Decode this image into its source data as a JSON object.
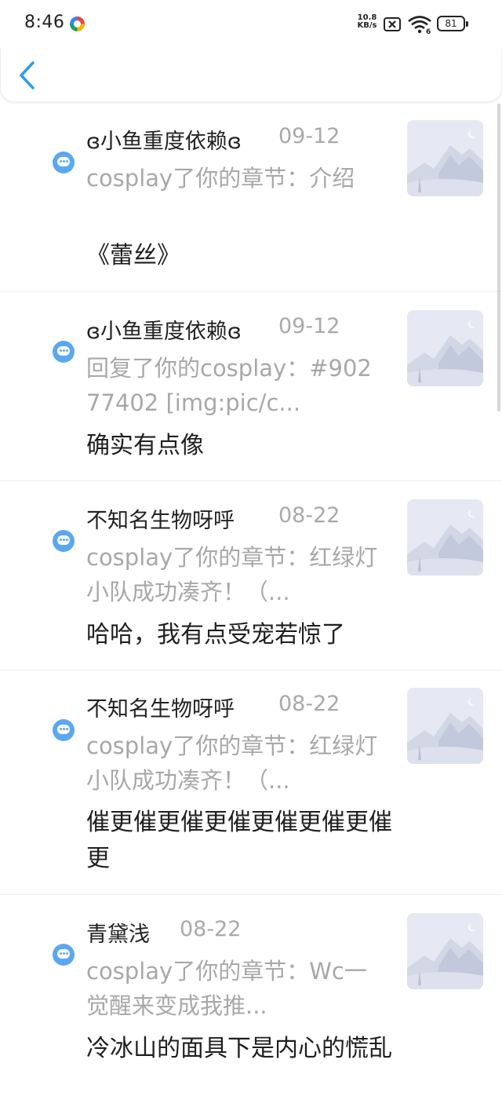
{
  "status_bar": {
    "time": "8:46",
    "net_speed_value": "10.8",
    "net_speed_unit": "KB/s",
    "battery": "81"
  },
  "header": {
    "back_icon": "chevron-left-icon",
    "accent_color": "#2e9bf0"
  },
  "notifications": [
    {
      "user": "ɞ小鱼重度依赖ɞ",
      "date": "09-12",
      "summary": "cosplay了你的章节：介绍",
      "reply": "《蕾丝》"
    },
    {
      "user": "ɞ小鱼重度依赖ɞ",
      "date": "09-12",
      "summary": "回复了你的cosplay：#90277402 [img:pic/c...",
      "reply": "确实有点像"
    },
    {
      "user": "不知名生物呀呼",
      "date": "08-22",
      "summary": "cosplay了你的章节：红绿灯小队成功凑齐！（...",
      "reply": "哈哈，我有点受宠若惊了"
    },
    {
      "user": "不知名生物呀呼",
      "date": "08-22",
      "summary": "cosplay了你的章节：红绿灯小队成功凑齐！（...",
      "reply": "催更催更催更催更催更催更催更"
    },
    {
      "user": "青黛浅",
      "date": "08-22",
      "summary": "cosplay了你的章节：Wc一觉醒来变成我推...",
      "reply": "冷冰山的面具下是内心的慌乱"
    }
  ]
}
